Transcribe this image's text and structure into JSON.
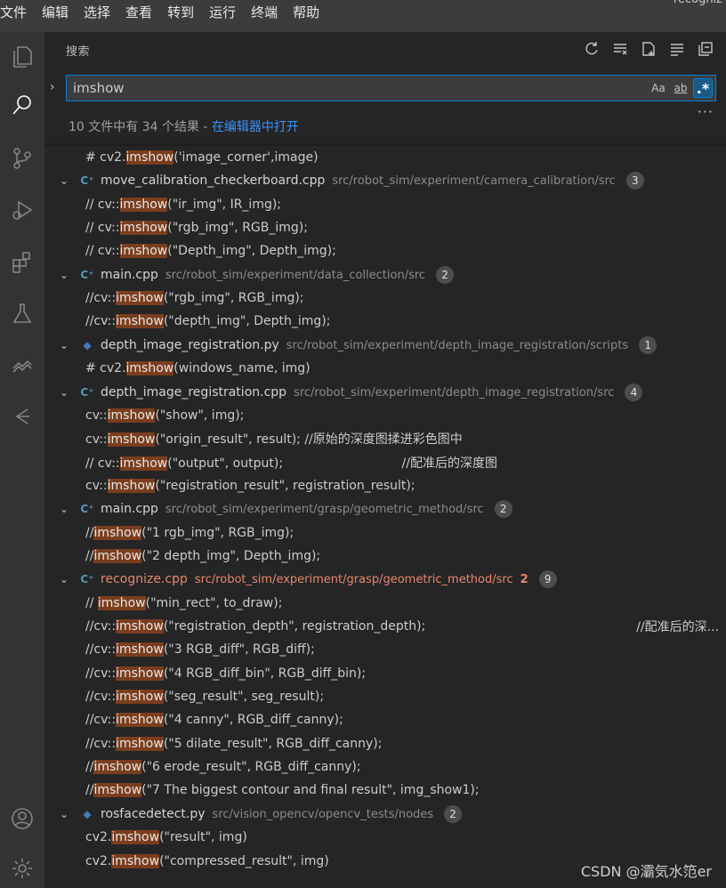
{
  "menu": {
    "items": [
      "文件",
      "编辑",
      "选择",
      "查看",
      "转到",
      "运行",
      "终端",
      "帮助"
    ],
    "window_title": "recogniz"
  },
  "sidebar": {
    "title": "搜索",
    "search_value": "imshow",
    "options": {
      "match_case": "Aa",
      "whole_word": "ab",
      "regex": ".*"
    },
    "summary_text": "10 文件中有 34 个结果 - ",
    "summary_link": "在编辑器中打开"
  },
  "results": [
    {
      "kind": "match",
      "prefix": "# cv2.",
      "hit": "imshow",
      "suffix": "('image_corner',image)"
    },
    {
      "kind": "file",
      "lang": "cpp",
      "name": "move_calibration_checkerboard.cpp",
      "path": "src/robot_sim/experiment/camera_calibration/src",
      "count": "3"
    },
    {
      "kind": "match",
      "prefix": "// cv::",
      "hit": "imshow",
      "suffix": "(\"ir_img\", IR_img);"
    },
    {
      "kind": "match",
      "prefix": "// cv::",
      "hit": "imshow",
      "suffix": "(\"rgb_img\", RGB_img);"
    },
    {
      "kind": "match",
      "prefix": "// cv::",
      "hit": "imshow",
      "suffix": "(\"Depth_img\", Depth_img);"
    },
    {
      "kind": "file",
      "lang": "cpp",
      "name": "main.cpp",
      "path": "src/robot_sim/experiment/data_collection/src",
      "count": "2"
    },
    {
      "kind": "match",
      "prefix": "//cv::",
      "hit": "imshow",
      "suffix": "(\"rgb_img\", RGB_img);"
    },
    {
      "kind": "match",
      "prefix": "//cv::",
      "hit": "imshow",
      "suffix": "(\"depth_img\", Depth_img);"
    },
    {
      "kind": "file",
      "lang": "py",
      "name": "depth_image_registration.py",
      "path": "src/robot_sim/experiment/depth_image_registration/scripts",
      "count": "1"
    },
    {
      "kind": "match",
      "prefix": "# cv2.",
      "hit": "imshow",
      "suffix": "(windows_name, img)"
    },
    {
      "kind": "file",
      "lang": "cpp",
      "name": "depth_image_registration.cpp",
      "path": "src/robot_sim/experiment/depth_image_registration/src",
      "count": "4"
    },
    {
      "kind": "match",
      "prefix": "cv::",
      "hit": "imshow",
      "suffix": "(\"show\", img);"
    },
    {
      "kind": "match",
      "prefix": "cv::",
      "hit": "imshow",
      "suffix": "(\"origin_result\", result); //原始的深度图揉进彩色图中"
    },
    {
      "kind": "match",
      "prefix": "// cv::",
      "hit": "imshow",
      "suffix": "(\"output\", output);                              //配准后的深度图"
    },
    {
      "kind": "match",
      "prefix": "cv::",
      "hit": "imshow",
      "suffix": "(\"registration_result\", registration_result);"
    },
    {
      "kind": "file",
      "lang": "cpp",
      "name": "main.cpp",
      "path": "src/robot_sim/experiment/grasp/geometric_method/src",
      "count": "2"
    },
    {
      "kind": "match",
      "prefix": "//",
      "hit": "imshow",
      "suffix": "(\"1 rgb_img\", RGB_img);"
    },
    {
      "kind": "match",
      "prefix": "//",
      "hit": "imshow",
      "suffix": "(\"2 depth_img\", Depth_img);"
    },
    {
      "kind": "file",
      "lang": "cpp",
      "name": "recognize.cpp",
      "path": "src/robot_sim/experiment/grasp/geometric_method/src",
      "modified": "2",
      "count": "9"
    },
    {
      "kind": "match",
      "prefix": "// ",
      "hit": "imshow",
      "suffix": "(\"min_rect\", to_draw);"
    },
    {
      "kind": "match",
      "prefix": "//cv::",
      "hit": "imshow",
      "suffix": "(\"registration_depth\", registration_depth);",
      "tail": "//配准后的深..."
    },
    {
      "kind": "match",
      "prefix": "//cv::",
      "hit": "imshow",
      "suffix": "(\"3 RGB_diff\", RGB_diff);"
    },
    {
      "kind": "match",
      "prefix": "//cv::",
      "hit": "imshow",
      "suffix": "(\"4 RGB_diff_bin\", RGB_diff_bin);"
    },
    {
      "kind": "match",
      "prefix": "//cv::",
      "hit": "imshow",
      "suffix": "(\"seg_result\", seg_result);"
    },
    {
      "kind": "match",
      "prefix": "//cv::",
      "hit": "imshow",
      "suffix": "(\"4 canny\", RGB_diff_canny);"
    },
    {
      "kind": "match",
      "prefix": "//cv::",
      "hit": "imshow",
      "suffix": "(\"5 dilate_result\", RGB_diff_canny);"
    },
    {
      "kind": "match",
      "prefix": "//",
      "hit": "imshow",
      "suffix": "(\"6 erode_result\", RGB_diff_canny);"
    },
    {
      "kind": "match",
      "prefix": "//",
      "hit": "imshow",
      "suffix": "(\"7 The biggest contour and final result\", img_show1);"
    },
    {
      "kind": "file",
      "lang": "py",
      "name": "rosfacedetect.py",
      "path": "src/vision_opencv/opencv_tests/nodes",
      "count": "2"
    },
    {
      "kind": "match",
      "prefix": "cv2.",
      "hit": "imshow",
      "suffix": "(\"result\", img)"
    },
    {
      "kind": "match",
      "prefix": "cv2.",
      "hit": "imshow",
      "suffix": "(\"compressed_result\", img)"
    }
  ],
  "watermark": "CSDN @灞気水笵er",
  "colors": {
    "highlight": "#7a3e1e",
    "accent": "#007fd4",
    "link": "#3794ff",
    "modified": "#e8876b"
  }
}
